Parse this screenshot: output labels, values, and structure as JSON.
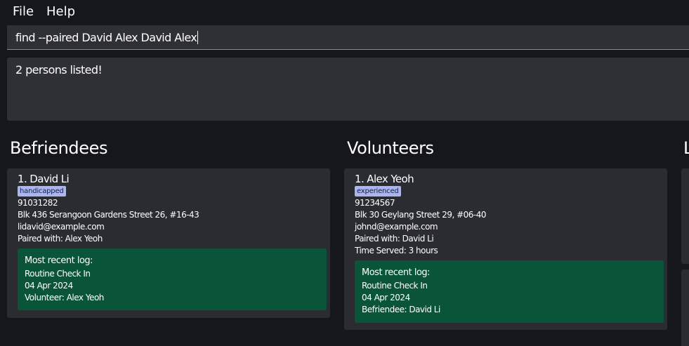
{
  "menu": {
    "file": "File",
    "help": "Help"
  },
  "command_box": {
    "value": "find --paired David Alex David Alex"
  },
  "result_display": {
    "text": "2 persons listed!"
  },
  "befriendees": {
    "title": "Befriendees",
    "cards": [
      {
        "index_name": "1.  David Li",
        "tag": "handicapped",
        "phone": "91031282",
        "address": "Blk 436 Serangoon Gardens Street 26, #16-43",
        "email": "lidavid@example.com",
        "paired": "Paired with: Alex Yeoh",
        "log": {
          "title": "Most recent log:",
          "log_title": "Routine Check In",
          "date": "04 Apr 2024",
          "person": "Volunteer: Alex Yeoh"
        }
      }
    ]
  },
  "volunteers": {
    "title": "Volunteers",
    "cards": [
      {
        "index_name": "1.  Alex Yeoh",
        "tag": "experienced",
        "phone": "91234567",
        "address": "Blk 30 Geylang Street 29, #06-40",
        "email": "johnd@example.com",
        "paired": "Paired with: David Li",
        "time_served": "Time Served: 3 hours",
        "log": {
          "title": "Most recent log:",
          "log_title": "Routine Check In",
          "date": "04 Apr 2024",
          "person": "Befriendee: David Li"
        }
      }
    ]
  },
  "logs_panel": {
    "title_partial": "L"
  },
  "colors": {
    "background": "#16171c",
    "input_background": "#2f3036",
    "card_background": "#2b2c32",
    "log_background": "#0a5539",
    "tag_background": "#a9b6f2"
  }
}
